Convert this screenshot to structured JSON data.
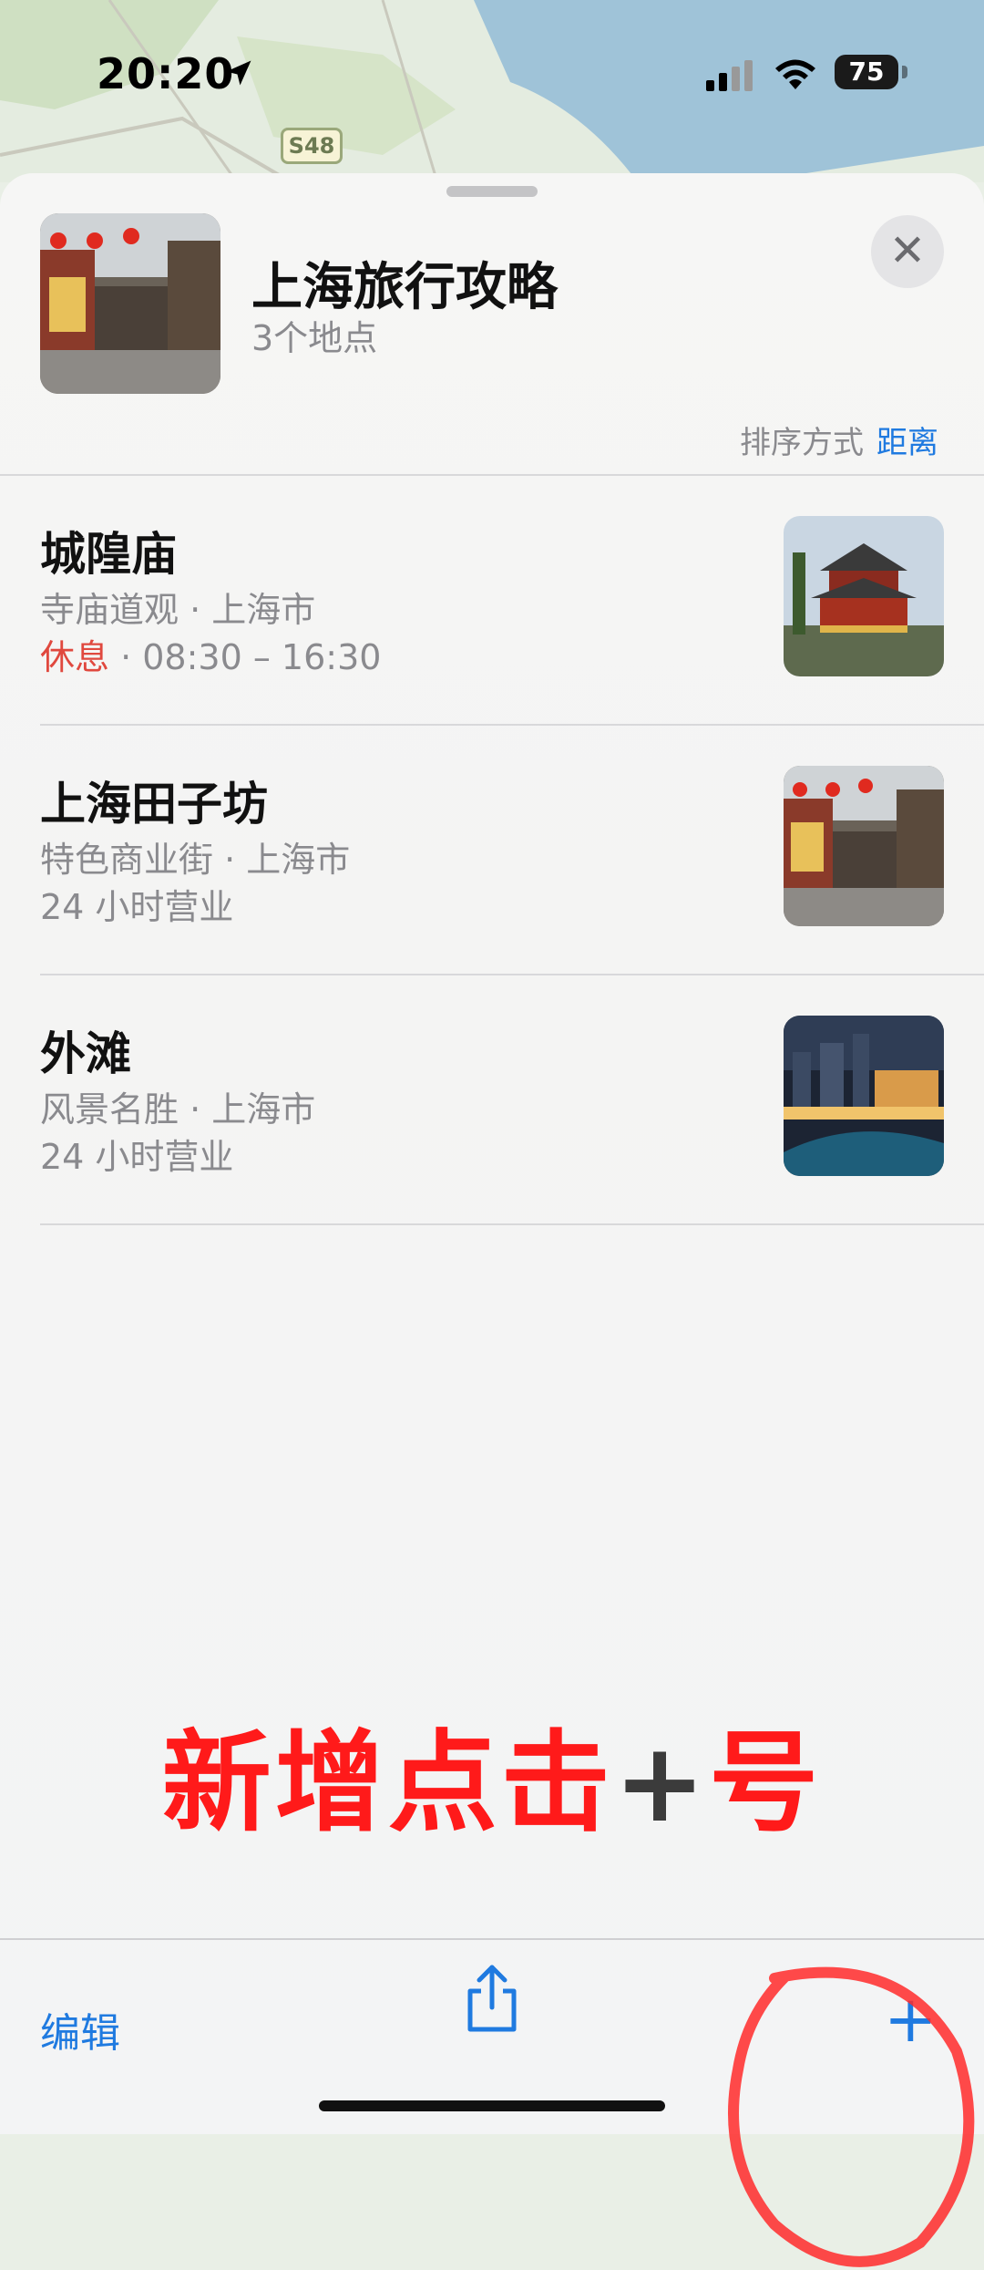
{
  "status_bar": {
    "time": "20:20",
    "battery": "75"
  },
  "map": {
    "route_label": "S48"
  },
  "header": {
    "title": "上海旅行攻略",
    "subtitle": "3个地点",
    "sort_label": "排序方式",
    "sort_value": "距离"
  },
  "places": [
    {
      "name": "城隍庙",
      "category": "寺庙道观 · 上海市",
      "status": "休息",
      "hours": " · 08:30 – 16:30"
    },
    {
      "name": "上海田子坊",
      "category": "特色商业街 · 上海市",
      "status": "",
      "hours": "24 小时营业"
    },
    {
      "name": "外滩",
      "category": "风景名胜 · 上海市",
      "status": "",
      "hours": "24 小时营业"
    }
  ],
  "annotation": {
    "text_before": "新增点击",
    "plus": "+",
    "text_after": "号"
  },
  "toolbar": {
    "edit_label": "编辑",
    "add_label": "+"
  },
  "colors": {
    "accent": "#1f7ae0",
    "closed": "#e0483e",
    "annotation": "#ff1a1a"
  }
}
